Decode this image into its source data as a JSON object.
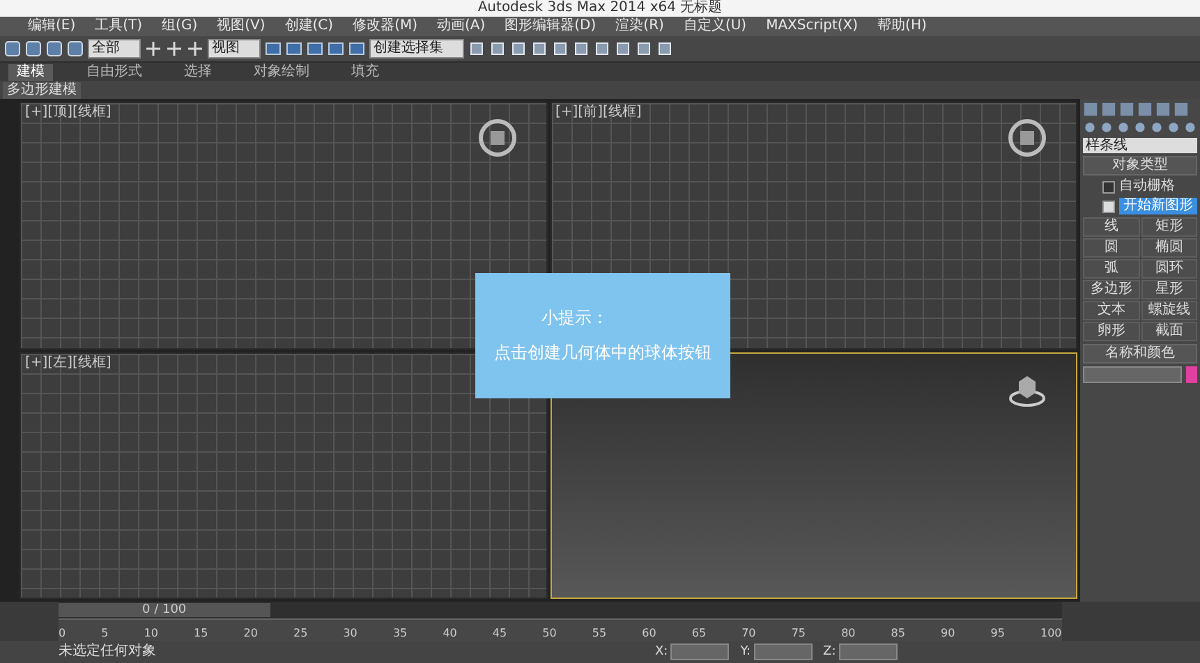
{
  "window": {
    "title": "Autodesk 3ds Max 2014 x64    无标题"
  },
  "menu": [
    "编辑(E)",
    "工具(T)",
    "组(G)",
    "视图(V)",
    "创建(C)",
    "修改器(M)",
    "动画(A)",
    "图形编辑器(D)",
    "渲染(R)",
    "自定义(U)",
    "MAXScript(X)",
    "帮助(H)"
  ],
  "toolbar": {
    "filter": "全部",
    "coord": "视图",
    "selection_set": "创建选择集"
  },
  "ribbon": {
    "tabs": [
      {
        "label": "建模",
        "selected": true
      },
      {
        "label": "自由形式",
        "selected": false
      },
      {
        "label": "选择",
        "selected": false
      },
      {
        "label": "对象绘制",
        "selected": false
      },
      {
        "label": "填充",
        "selected": false
      }
    ],
    "subtab": "多边形建模"
  },
  "viewports": [
    {
      "label": "[+][顶][线框]",
      "selected": false,
      "kind": "ortho",
      "view_cube": true
    },
    {
      "label": "[+][前][线框]",
      "selected": false,
      "kind": "ortho",
      "view_cube": true
    },
    {
      "label": "[+][左][线框]",
      "selected": false,
      "kind": "ortho",
      "view_cube": false
    },
    {
      "selected": true,
      "kind": "perspective",
      "view_cube": true
    }
  ],
  "tip": {
    "title": "小提示：",
    "text": "点击创建几何体中的球体按钮"
  },
  "command_panel": {
    "category": "样条线",
    "rollout": "对象类型",
    "auto_grid": {
      "label": "自动栅格",
      "checked": false
    },
    "start_new": {
      "label": "开始新图形",
      "checked": true
    },
    "buttons": [
      "线",
      "矩形",
      "圆",
      "椭圆",
      "弧",
      "圆环",
      "多边形",
      "星形",
      "文本",
      "螺旋线",
      "卵形",
      "截面"
    ],
    "name_rollout": "名称和颜色",
    "color": "#e040a0"
  },
  "timeline": {
    "position": "0 / 100",
    "ticks": [
      "0",
      "5",
      "10",
      "15",
      "20",
      "25",
      "30",
      "35",
      "40",
      "45",
      "50",
      "55",
      "60",
      "65",
      "70",
      "75",
      "80",
      "85",
      "90",
      "95",
      "100"
    ]
  },
  "status_bar": {
    "message": "未选定任何对象",
    "fields": [
      "X:",
      "Y:",
      "Z:"
    ]
  }
}
